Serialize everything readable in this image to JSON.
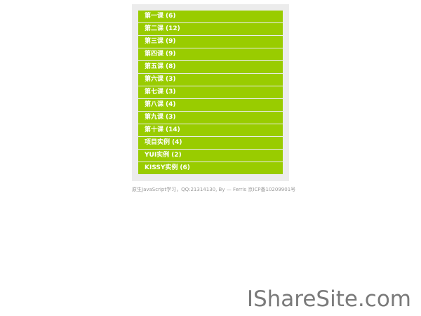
{
  "menu": {
    "items": [
      {
        "label": "第一课",
        "count": "(6)"
      },
      {
        "label": "第二课",
        "count": "(12)"
      },
      {
        "label": "第三课",
        "count": "(9)"
      },
      {
        "label": "第四课",
        "count": "(9)"
      },
      {
        "label": "第五课",
        "count": "(8)"
      },
      {
        "label": "第六课",
        "count": "(3)"
      },
      {
        "label": "第七课",
        "count": "(3)"
      },
      {
        "label": "第八课",
        "count": "(4)"
      },
      {
        "label": "第九课",
        "count": "(3)"
      },
      {
        "label": "第十课",
        "count": "(14)"
      },
      {
        "label": "项目实例",
        "count": "(4)"
      },
      {
        "label": "YUI实例",
        "count": "(2)"
      },
      {
        "label": "KISSY实例",
        "count": "(6)"
      }
    ],
    "item_bg_color": "#99cc00",
    "frame_bg_color": "#ececec",
    "text_color": "#ffffff"
  },
  "footer": {
    "text": "原生JavaScript学习，QQ:21314130, By — Ferris 京ICP备10209901号"
  },
  "watermark": {
    "text": "IShareSite.com"
  }
}
